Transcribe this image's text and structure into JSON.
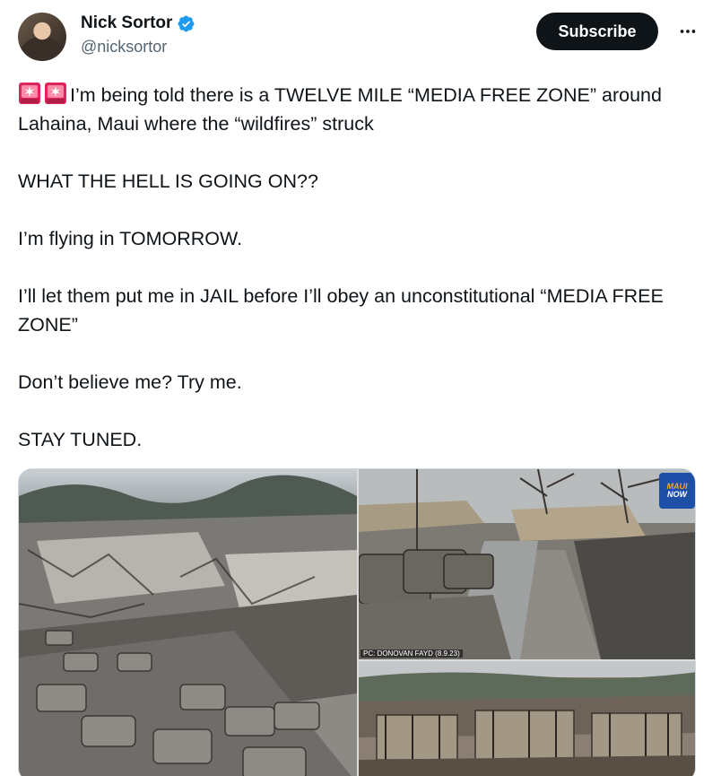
{
  "author": {
    "display_name": "Nick Sortor",
    "handle": "@nicksortor",
    "verified": true
  },
  "actions": {
    "subscribe_label": "Subscribe",
    "more_icon": "more-horizontal-icon"
  },
  "tweet": {
    "line1": "I’m being told there is a TWELVE MILE “MEDIA FREE ZONE” around Lahaina, Maui where the “wildfires” struck",
    "line2": "WHAT THE HELL IS GOING ON??",
    "line3": "I’m flying in TOMORROW.",
    "line4": "I’ll let them put me in JAIL before I’ll obey an unconstitutional “MEDIA FREE ZONE”",
    "line5": "Don’t believe me? Try me.",
    "line6": "STAY TUNED."
  },
  "media": {
    "photo_credit": "PC: DONOVAN FAYD (8.9.23)",
    "logo_line1": "MAUI",
    "logo_line2": "NOW"
  },
  "colors": {
    "brand_dark": "#0f1419",
    "secondary_text": "#536471",
    "verified_blue": "#1d9bf0",
    "siren_red": "#e0245e"
  }
}
